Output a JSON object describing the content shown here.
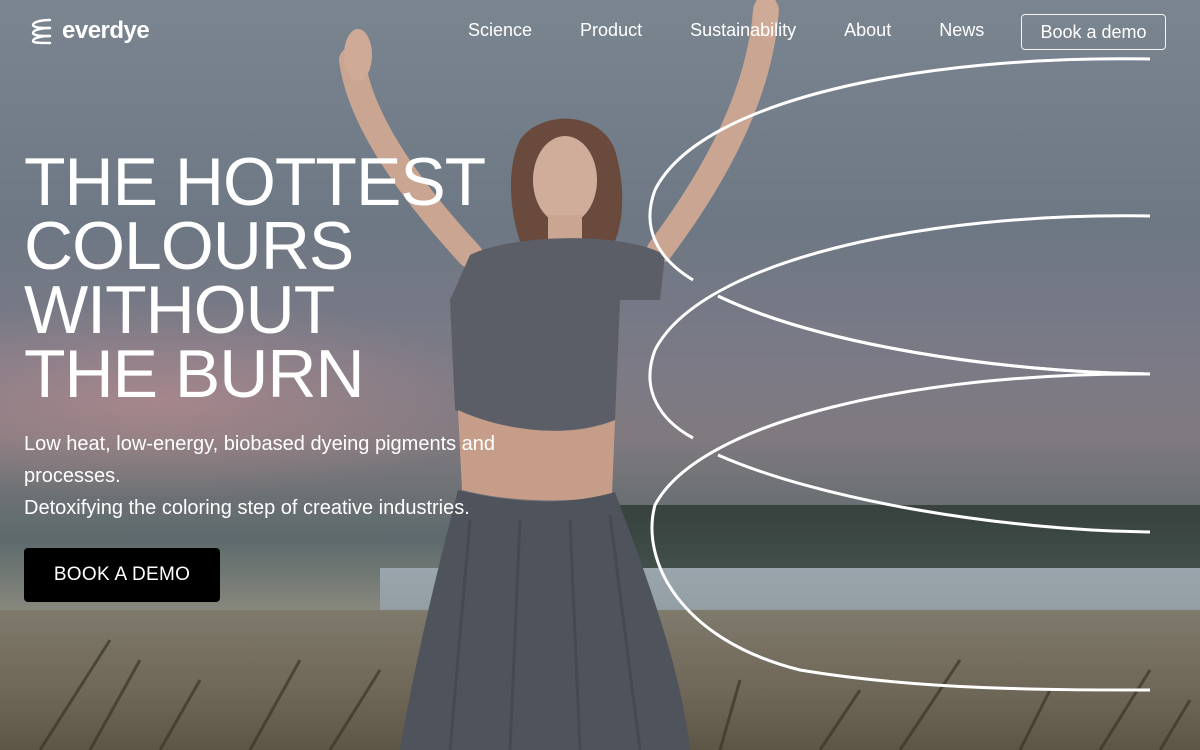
{
  "brand": {
    "name": "everdye"
  },
  "nav": {
    "links": [
      "Science",
      "Product",
      "Sustainability",
      "About",
      "News"
    ],
    "cta": "Book a demo"
  },
  "hero": {
    "headline": [
      "THE HOTTEST",
      "COLOURS",
      "WITHOUT",
      "THE BURN"
    ],
    "subtext": [
      "Low heat, low-energy, biobased dyeing pigments and processes.",
      "Detoxifying the coloring step of creative industries."
    ],
    "cta": "BOOK A DEMO"
  },
  "colors": {
    "text": "#ffffff",
    "button_bg": "#000000",
    "arc_stroke": "#ffffff"
  }
}
